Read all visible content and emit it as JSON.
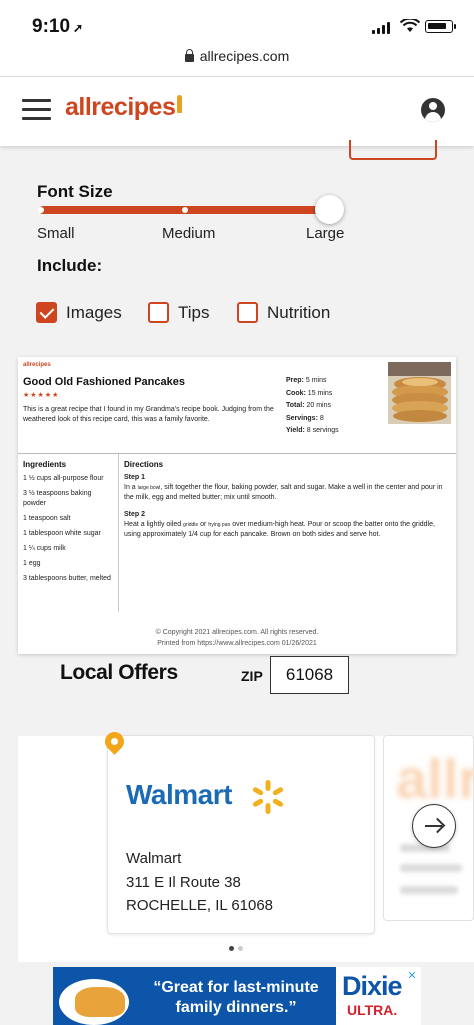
{
  "status_bar": {
    "time": "9:10",
    "location_glyph": "➚"
  },
  "browser": {
    "url": "allrecipes.com"
  },
  "header": {
    "logo_text": "allrecipes"
  },
  "options": {
    "font_size_heading": "Font Size",
    "sizes": [
      "Small",
      "Medium",
      "Large"
    ],
    "selected_size": "Large",
    "include_heading": "Include:",
    "include_options": [
      {
        "label": "Images",
        "checked": true
      },
      {
        "label": "Tips",
        "checked": false
      },
      {
        "label": "Nutrition",
        "checked": false
      }
    ]
  },
  "recipe_card": {
    "logo": "allrecipes",
    "title": "Good Old Fashioned Pancakes",
    "stars": "★★★★★",
    "description": "This is a great recipe that I found in my Grandma's recipe book. Judging from the weathered look of this recipe card, this was a family favorite.",
    "meta": [
      {
        "label": "Prep:",
        "value": "5 mins"
      },
      {
        "label": "Cook:",
        "value": "15 mins"
      },
      {
        "label": "Total:",
        "value": "20 mins"
      },
      {
        "label": "Servings:",
        "value": "8"
      },
      {
        "label": "Yield:",
        "value": "8 servings"
      }
    ],
    "ingredients_heading": "Ingredients",
    "ingredients": [
      "1 ½ cups all-purpose flour",
      "3 ½ teaspoons baking powder",
      "1 teaspoon salt",
      "1 tablespoon white sugar",
      "1 ¼ cups milk",
      "1 egg",
      "3 tablespoons butter, melted"
    ],
    "directions_heading": "Directions",
    "steps": [
      {
        "label": "Step 1",
        "before": "In a ",
        "small": "large bowl",
        "after": ", sift together the flour, baking powder, salt and sugar. Make a well in the center and pour in the milk, egg and melted butter; mix until smooth."
      },
      {
        "label": "Step 2",
        "before": "Heat a lightly oiled ",
        "small": "griddle",
        "middle": " or ",
        "small2": "frying pan",
        "after": " over medium-high heat. Pour or scoop the batter onto the griddle, using approximately 1/4 cup for each pancake. Brown on both sides and serve hot."
      }
    ],
    "copyright": "© Copyright 2021 allrecipes.com. All rights reserved.",
    "printed_from": "Printed from https://www.allrecipes.com 01/26/2021"
  },
  "local_offers": {
    "title": "Local Offers",
    "zip_label": "ZIP",
    "zip_value": "61068",
    "store": {
      "logo": "Walmart",
      "name": "Walmart",
      "address_line1": "311 E Il Route 38",
      "address_line2": "ROCHELLE, IL 61068"
    },
    "next_store_logo_partial": "allr",
    "carousel_page": 1,
    "carousel_total": 2
  },
  "ad": {
    "text": "“Great for last-minute family dinners.”",
    "brand": "Dixie",
    "brand_sub": "ULTRA.",
    "close_glyph": "✕"
  },
  "colors": {
    "accent": "#ce4620",
    "walmart_blue": "#1a6bb4",
    "walmart_spark": "#f2b01e",
    "ad_blue": "#0d55a8"
  },
  "icons": [
    "hamburger-icon",
    "user-icon",
    "lock-icon",
    "location-pin-icon",
    "arrow-right-icon",
    "walmart-spark-icon",
    "wifi-icon",
    "battery-icon",
    "signal-icon"
  ]
}
